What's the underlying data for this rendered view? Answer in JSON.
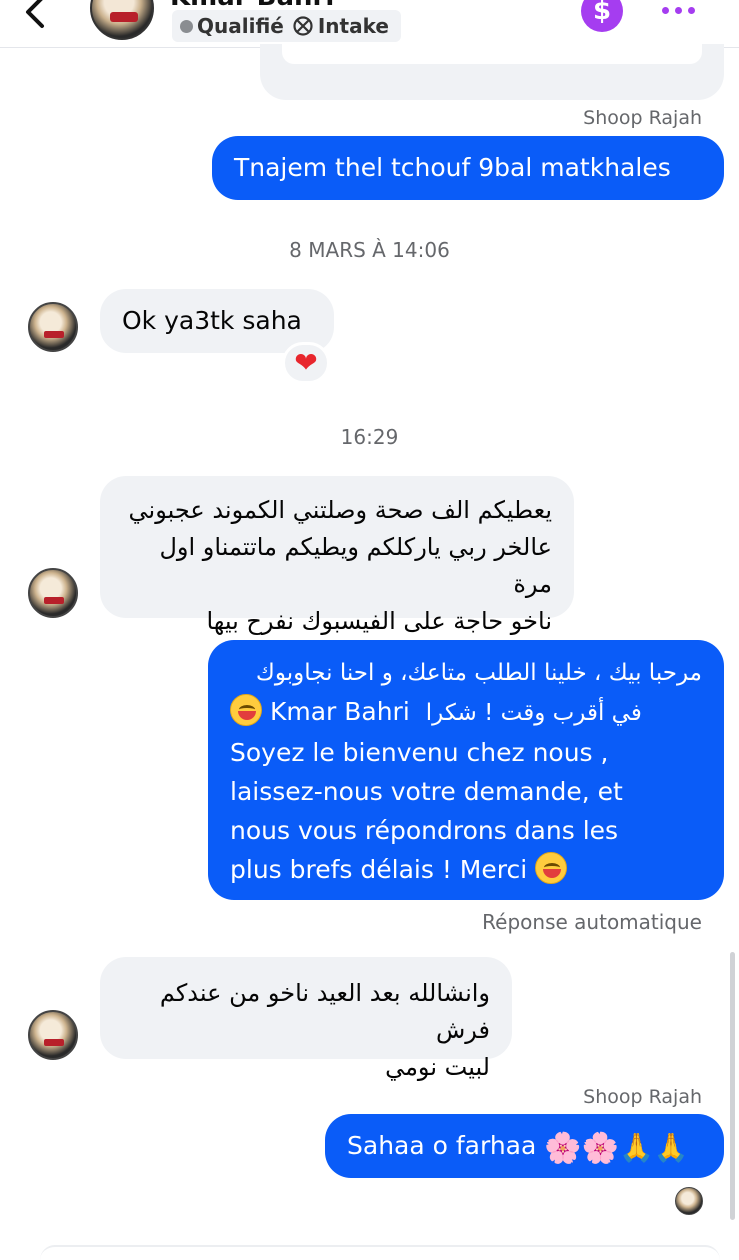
{
  "header": {
    "contact_name": "Kmar Bahri",
    "tag_status": "Qualifié",
    "tag_stage": "Intake",
    "dollar_symbol": "$",
    "accent_color": "#a53df0"
  },
  "messages": [
    {
      "sender_label": "Shoop Rajah",
      "direction": "out",
      "text": "Tnajem thel tchouf 9bal matkhales"
    },
    {
      "timestamp": "8 MARS À 14:06"
    },
    {
      "direction": "in",
      "text": "Ok ya3tk saha",
      "reaction": "❤"
    },
    {
      "timestamp": "16:29"
    },
    {
      "direction": "in",
      "lines": [
        "يعطيكم الف صحة وصلتني الكموند عجبوني",
        "عالخر ربي ياركلكم ويطيكم ماتتمناو اول مرة",
        "ناخو حاجة على الفيسبوك نفرح بيها"
      ]
    },
    {
      "direction": "out",
      "lines_rtl": [
        "مرحبا بيك ، خلينا الطلب متاعك، و احنا نجاوبوك",
        "في أقرب وقت ! شكرا"
      ],
      "inline_name": "Kmar Bahri",
      "lines": [
        "Soyez le bienvenu chez nous ,",
        "laissez-nous votre demande, et",
        "nous vous répondrons dans les",
        "plus brefs délais ! Merci"
      ],
      "auto_label": "Réponse automatique"
    },
    {
      "direction": "in",
      "lines": [
        "وانشالله بعد العيد ناخو من عندكم فرش",
        "لبيت نومي"
      ]
    },
    {
      "sender_label": "Shoop Rajah",
      "direction": "out",
      "text": "Sahaa o farhaa",
      "emoji_flower": "🌸",
      "emoji_pray": "🙏"
    }
  ],
  "colors": {
    "outgoing_bubble": "#0a5cf8",
    "incoming_bubble": "#f0f2f5",
    "reaction_heart": "#e8262d"
  }
}
